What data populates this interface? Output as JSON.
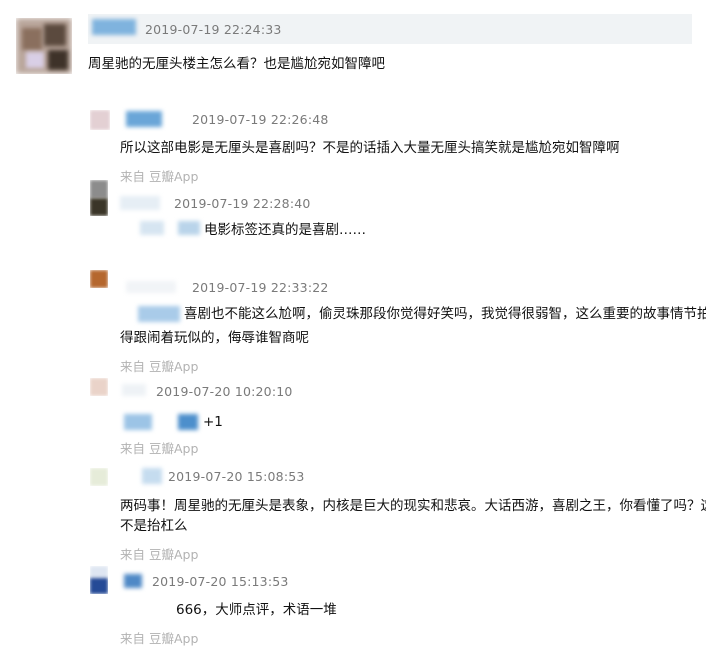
{
  "comments": [
    {
      "timestamp": "2019-07-19 22:24:33",
      "text": "周星驰的无厘头楼主怎么看？也是尴尬宛如智障吧"
    },
    {
      "timestamp": "2019-07-19 22:26:48",
      "text": "所以这部电影是无厘头是喜剧吗？不是的话插入大量无厘头搞笑就是尴尬宛如智障啊",
      "source": "来自 豆瓣App"
    },
    {
      "timestamp": "2019-07-19 22:28:40",
      "text": "电影标签还真的是喜剧……"
    },
    {
      "timestamp": "2019-07-19 22:33:22",
      "text_lines": [
        "喜剧也不能这么尬啊，偷灵珠那段你觉得好笑吗，我觉得很弱智，这么重要的故事情节拍",
        "得跟闹着玩似的，侮辱谁智商呢"
      ],
      "source": "来自 豆瓣App"
    },
    {
      "timestamp": "2019-07-20 10:20:10",
      "text": "+1",
      "source": "来自 豆瓣App"
    },
    {
      "timestamp": "2019-07-20 15:08:53",
      "text_lines": [
        "两码事！周星驰的无厘头是表象，内核是巨大的现实和悲哀。大话西游，喜剧之王，你看懂了吗？这",
        "不是抬杠么"
      ],
      "source": "来自 豆瓣App"
    },
    {
      "timestamp": "2019-07-20 15:13:53",
      "text": "666，大师点评，术语一堆",
      "source": "来自 豆瓣App"
    }
  ],
  "colors": {
    "timestamp": "#7a7a7a",
    "source": "#b2b2b2",
    "header_bg": "#f0f3f5",
    "name_blur": "#6fa8d8"
  },
  "icons": [
    "user-avatar"
  ]
}
